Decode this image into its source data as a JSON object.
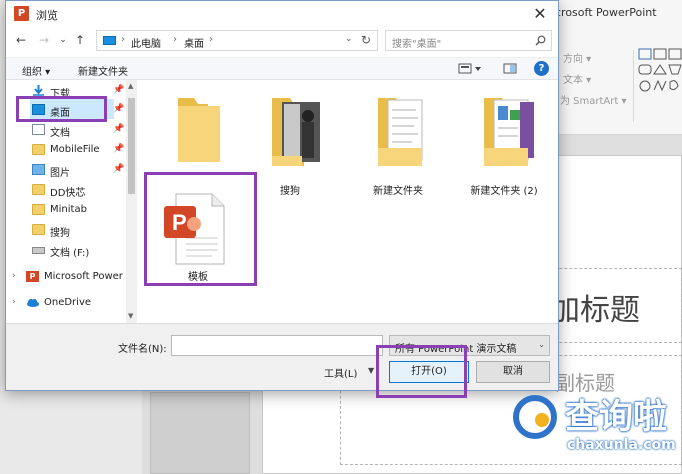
{
  "powerpoint": {
    "title": "crosoft PowerPoint",
    "ribbon_direction": "方向 ▾",
    "ribbon_text": "文本 ▾",
    "ribbon_smartart": "为 SmartArt ▾",
    "slide_title_placeholder": "加标题",
    "slide_subtitle_placeholder": "副标题"
  },
  "dialog": {
    "title": "浏览",
    "app_icon_letter": "P",
    "close": "✕"
  },
  "navigation": {
    "back": "←",
    "forward": "→",
    "recent": "⌄",
    "up": "↑",
    "breadcrumb": [
      "此电脑",
      "桌面"
    ],
    "search_placeholder": "搜索\"桌面\""
  },
  "toolbar": {
    "organize": "组织 ▾",
    "new_folder": "新建文件夹"
  },
  "nav_pane": {
    "items": [
      {
        "label": "下载",
        "pinned": true
      },
      {
        "label": "桌面",
        "pinned": true,
        "selected": true
      },
      {
        "label": "文档",
        "pinned": true
      },
      {
        "label": "MobileFile",
        "pinned": true
      },
      {
        "label": "图片",
        "pinned": true
      },
      {
        "label": "DD快芯",
        "pinned": false
      },
      {
        "label": "Minitab",
        "pinned": false
      },
      {
        "label": "搜狗",
        "pinned": false
      },
      {
        "label": "文档 (F:)",
        "pinned": false
      },
      {
        "label": "Microsoft Power",
        "pinned": false
      },
      {
        "label": "OneDrive",
        "pinned": false
      }
    ]
  },
  "files": [
    {
      "name": "",
      "type": "folder"
    },
    {
      "name": "搜狗",
      "type": "folder-photo"
    },
    {
      "name": "新建文件夹",
      "type": "folder-docs"
    },
    {
      "name": "新建文件夹 (2)",
      "type": "folder-docs"
    },
    {
      "name": "模板",
      "type": "powerpoint-file"
    }
  ],
  "bottom": {
    "filename_label": "文件名(N):",
    "filename_value": "",
    "filetype": "所有 PowerPoint 演示文稿",
    "tools": "工具(L)",
    "open": "打开(O)",
    "cancel": "取消"
  },
  "watermark": {
    "brand": "查询啦",
    "domain": "chaxunla.com"
  },
  "colors": {
    "highlight": "#8a3fb5",
    "selection": "#cce8ff",
    "accent": "#0078d7",
    "ppt_orange": "#d24726"
  }
}
